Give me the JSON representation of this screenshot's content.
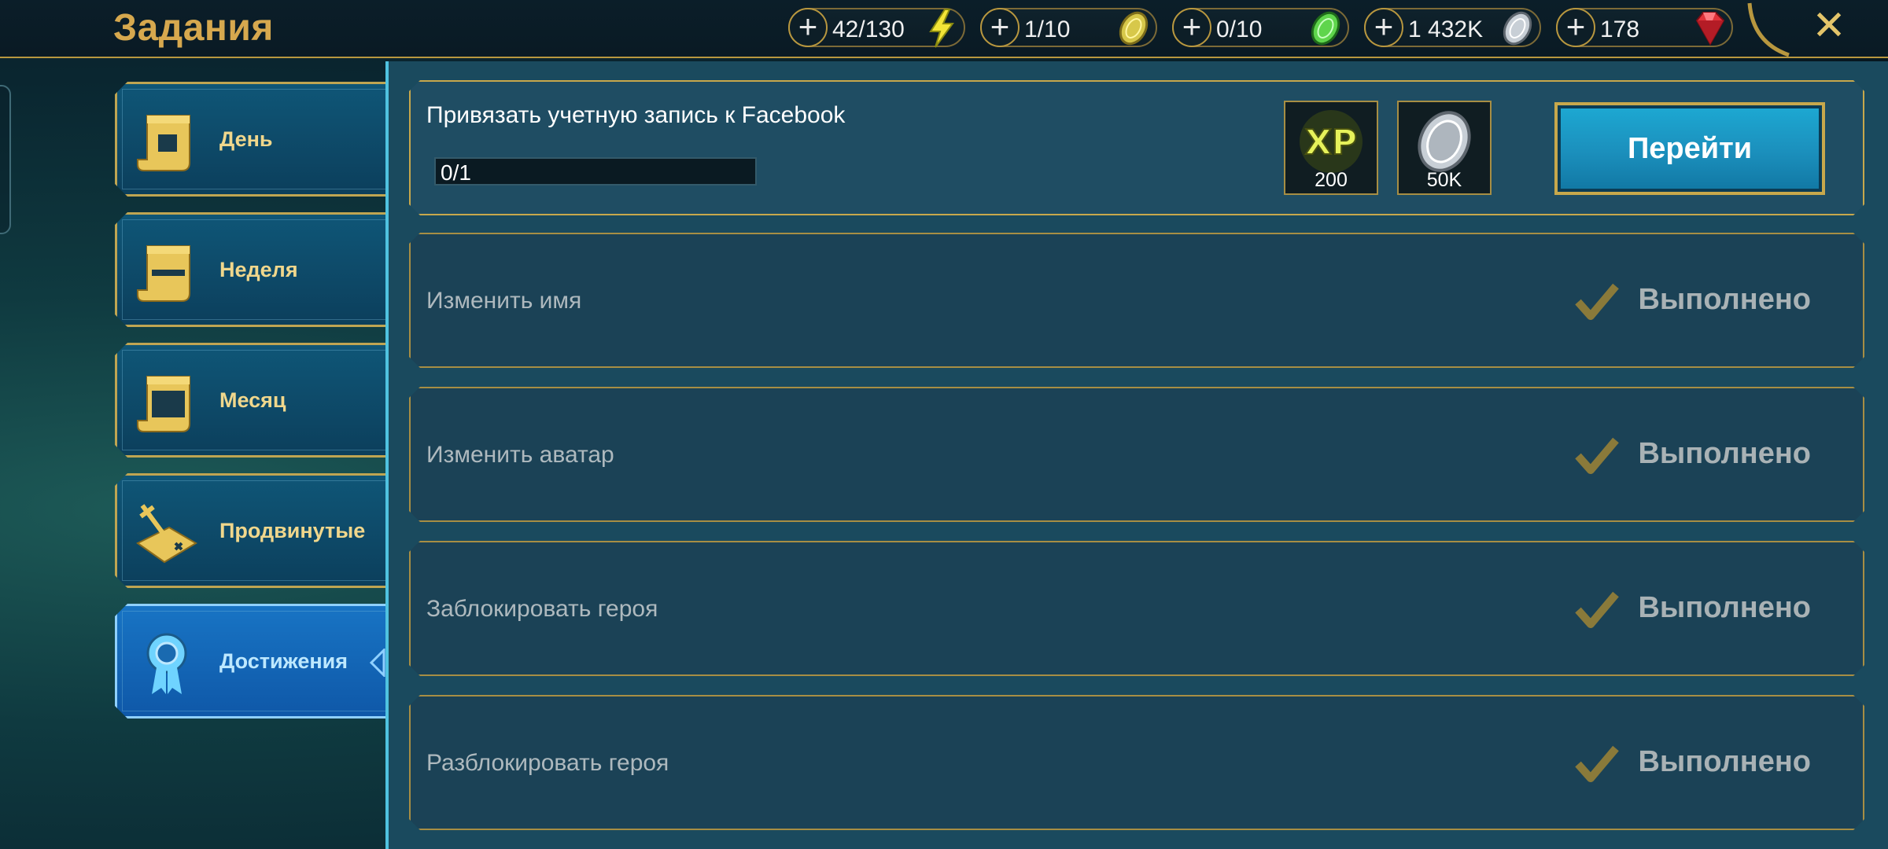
{
  "header": {
    "title": "Задания",
    "close_label": "✕",
    "resources": [
      {
        "name": "energy",
        "value": "42/130",
        "icon": "lightning-icon",
        "color": "#f3e537"
      },
      {
        "name": "gold-key",
        "value": "1/10",
        "icon": "gold-coin-icon",
        "color": "#d7c84a"
      },
      {
        "name": "green-key",
        "value": "0/10",
        "icon": "green-gem-icon",
        "color": "#5fd54c"
      },
      {
        "name": "silver",
        "value": "1 432K",
        "icon": "silver-coin-icon",
        "color": "#c8cfd6"
      },
      {
        "name": "gems",
        "value": "178",
        "icon": "ruby-icon",
        "color": "#e0323a"
      }
    ]
  },
  "sidebar": {
    "tabs": [
      {
        "label": "День",
        "icon": "scroll-icon",
        "active": false
      },
      {
        "label": "Неделя",
        "icon": "scroll-icon",
        "active": false
      },
      {
        "label": "Месяц",
        "icon": "scroll-icon",
        "active": false
      },
      {
        "label": "Продвинутые",
        "icon": "sword-map-icon",
        "active": false
      },
      {
        "label": "Достижения",
        "icon": "award-ribbon-icon",
        "active": true
      }
    ]
  },
  "quests": [
    {
      "title": "Привязать учетную запись к Facebook",
      "progress_text": "0/1",
      "progress": 0,
      "rewards": [
        {
          "icon": "xp-icon",
          "label": "200"
        },
        {
          "icon": "silver-coin-icon",
          "label": "50K"
        }
      ],
      "button_label": "Перейти"
    },
    {
      "title": "Изменить имя",
      "status": "Выполнено"
    },
    {
      "title": "Изменить аватар",
      "status": "Выполнено"
    },
    {
      "title": "Заблокировать героя",
      "status": "Выполнено"
    },
    {
      "title": "Разблокировать героя",
      "status": "Выполнено"
    }
  ]
}
